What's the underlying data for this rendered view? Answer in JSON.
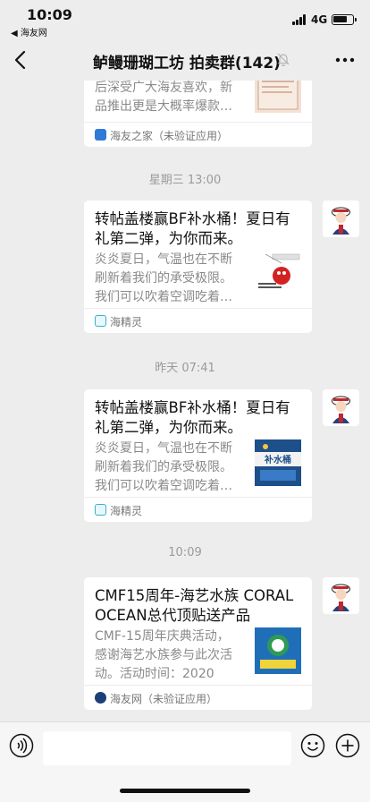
{
  "status_bar": {
    "time": "10:09",
    "back_app": "◀ 海友网",
    "network": "4G"
  },
  "nav": {
    "title": "鲈鳗珊瑚工坊 拍卖群(142)"
  },
  "messages": [
    {
      "type": "card",
      "title": "",
      "description": "后深受广大海友喜欢，新品推出更是大概率爆款…",
      "source": "海友之家（未验证应用）",
      "source_icon": "haiyou-home-icon"
    },
    {
      "type": "time",
      "text": "星期三 13:00"
    },
    {
      "type": "card",
      "title": "转帖盖楼赢BF补水桶！夏日有礼第二弹，为你而来。",
      "description": "炎炎夏日，气温也在不断刷新着我们的承受极限。我们可以吹着空调吃着…",
      "source": "海精灵",
      "source_icon": "haijingling-icon"
    },
    {
      "type": "time",
      "text": "昨天 07:41"
    },
    {
      "type": "card",
      "title": "转帖盖楼赢BF补水桶！夏日有礼第二弹，为你而来。",
      "description": "炎炎夏日，气温也在不断刷新着我们的承受极限。我们可以吹着空调吃着…",
      "thumb_caption": "补水桶",
      "source": "海精灵",
      "source_icon": "haijingling-icon"
    },
    {
      "type": "time",
      "text": "10:09"
    },
    {
      "type": "card",
      "title": "CMF15周年-海艺水族 CORAL OCEAN总代顶贴送产品",
      "description": "CMF-15周年庆典活动，感谢海艺水族参与此次活动。活动时间：2020年…",
      "source": "海友网（未验证应用）",
      "source_icon": "haiyouwang-icon"
    }
  ],
  "colors": {
    "background": "#ededed",
    "card": "#ffffff",
    "secondary_text": "#8a8a8a"
  }
}
